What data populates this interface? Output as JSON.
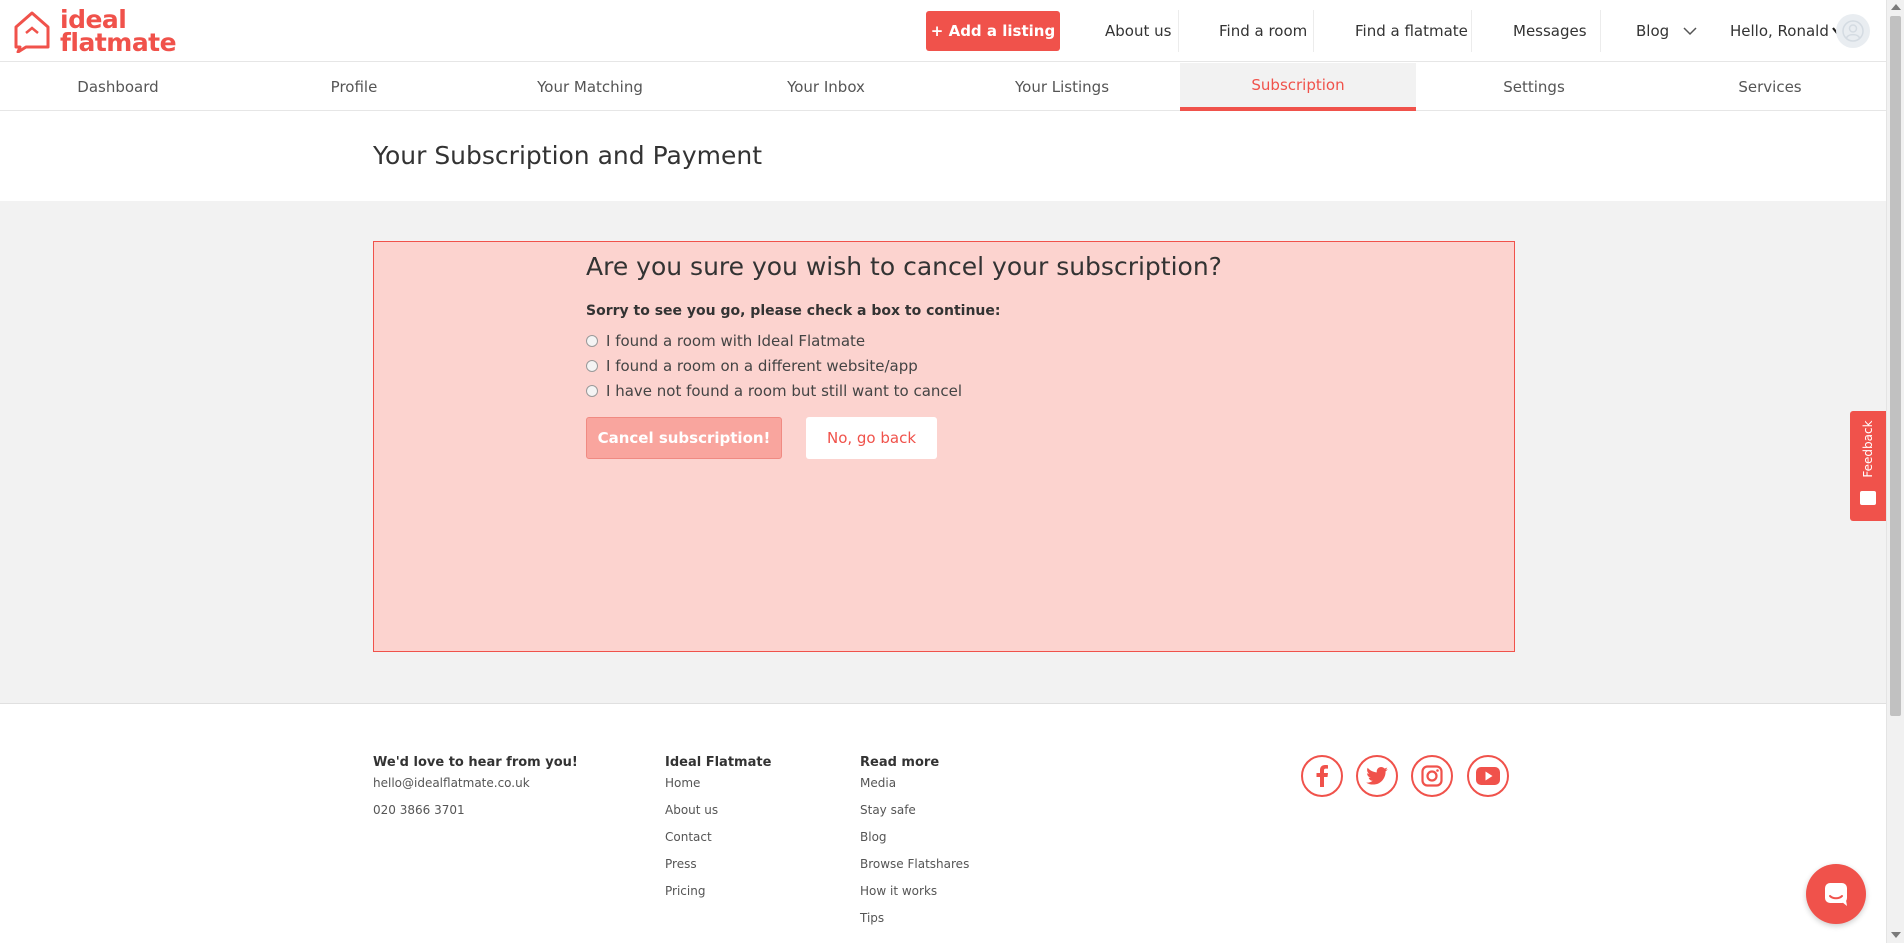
{
  "brand": {
    "name_line1": "ideal",
    "name_line2": "flatmate",
    "accent_color": "#f0524b"
  },
  "header": {
    "add_listing": "+ Add a listing",
    "nav": [
      "About us",
      "Find a room",
      "Find a flatmate",
      "Messages",
      "Blog"
    ],
    "greeting": "Hello, Ronald"
  },
  "subnav": {
    "items": [
      "Dashboard",
      "Profile",
      "Your Matching",
      "Your Inbox",
      "Your Listings",
      "Subscription",
      "Settings",
      "Services"
    ],
    "active": "Subscription"
  },
  "page": {
    "title": "Your Subscription and Payment"
  },
  "cancel": {
    "heading": "Are you sure you wish to cancel your subscription?",
    "prompt": "Sorry to see you go, please check a box to continue:",
    "options": [
      "I found a room with Ideal Flatmate",
      "I found a room on a different website/app",
      "I have not found a room but still want to cancel"
    ],
    "confirm_label": "Cancel subscription!",
    "back_label": "No, go back"
  },
  "footer": {
    "contact": {
      "heading": "We'd love to hear from you!",
      "email": "hello@idealflatmate.co.uk",
      "phone": "020 3866 3701"
    },
    "ideal_flatmate": {
      "heading": "Ideal Flatmate",
      "links": [
        "Home",
        "About us",
        "Contact",
        "Press",
        "Pricing"
      ]
    },
    "read_more": {
      "heading": "Read more",
      "links": [
        "Media",
        "Stay safe",
        "Blog",
        "Browse Flatshares",
        "How it works",
        "Tips"
      ]
    },
    "social_icons": [
      "facebook-icon",
      "twitter-icon",
      "instagram-icon",
      "youtube-icon"
    ]
  },
  "feedback": {
    "label": "Feedback"
  }
}
